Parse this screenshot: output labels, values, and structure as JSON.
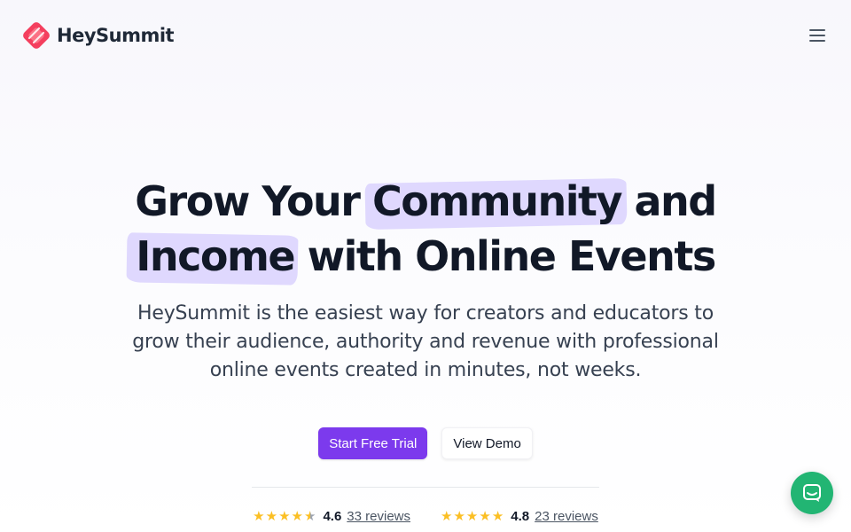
{
  "brand": {
    "name": "HeySummit",
    "logo_colors": [
      "#f43f5e",
      "#ec4899"
    ]
  },
  "nav": {
    "menu_icon": "hamburger-menu-icon"
  },
  "hero": {
    "headline_pre": "Grow Your ",
    "headline_highlight_1": "Community",
    "headline_mid": " and",
    "headline_highlight_2": "Income",
    "headline_post": " with Online Events",
    "subtitle": "HeySummit is the easiest way for creators and educators to grow their audience, authority and revenue with professional online events created in minutes, not weeks.",
    "highlight_color": "#ddd6fe"
  },
  "cta": {
    "primary_label": "Start Free Trial",
    "secondary_label": "View Demo",
    "primary_color": "#7c3aed"
  },
  "ratings": [
    {
      "stars": 4.6,
      "score": "4.6",
      "reviews_label": "33 reviews"
    },
    {
      "stars": 4.8,
      "score": "4.8",
      "reviews_label": "23 reviews"
    }
  ],
  "chat": {
    "icon": "chat-bubble-icon",
    "color": "#22b573"
  }
}
